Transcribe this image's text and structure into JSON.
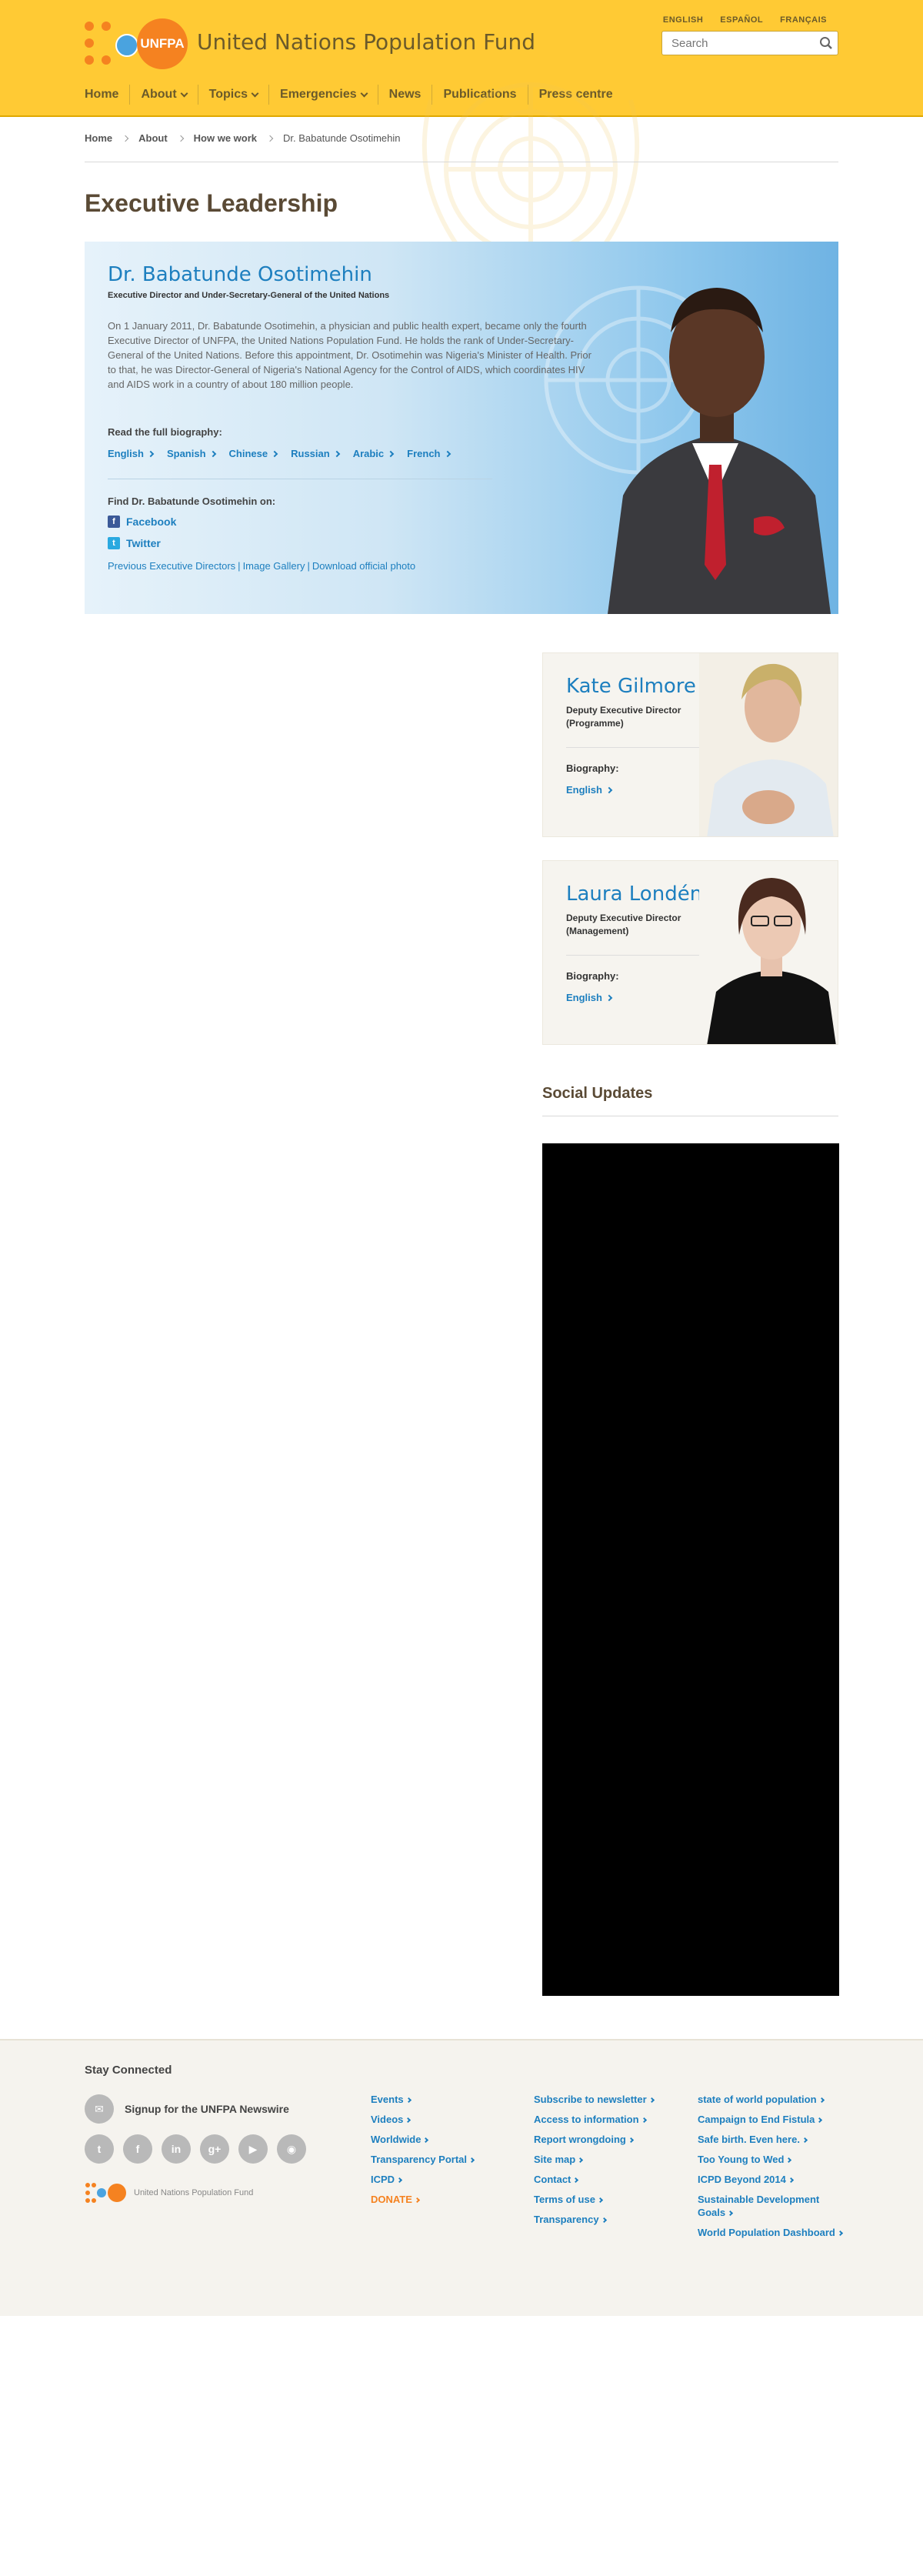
{
  "header": {
    "logo_text": "UNFPA",
    "site_title": "United Nations Population Fund",
    "languages": [
      "ENGLISH",
      "ESPAÑOL",
      "FRANÇAIS"
    ],
    "search_placeholder": "Search",
    "nav": [
      {
        "label": "Home",
        "dropdown": false
      },
      {
        "label": "About",
        "dropdown": true
      },
      {
        "label": "Topics",
        "dropdown": true
      },
      {
        "label": "Emergencies",
        "dropdown": true
      },
      {
        "label": "News",
        "dropdown": false
      },
      {
        "label": "Publications",
        "dropdown": false
      },
      {
        "label": "Press centre",
        "dropdown": false
      }
    ]
  },
  "breadcrumb": [
    "Home",
    "About",
    "How we work",
    "Dr. Babatunde Osotimehin"
  ],
  "page_title": "Executive Leadership",
  "feature": {
    "name": "Dr. Babatunde Osotimehin",
    "role": "Executive Director and Under-Secretary-General of the United Nations",
    "bio": "On 1 January 2011, Dr. Babatunde Osotimehin, a physician and public health expert, became only the fourth Executive Director of UNFPA, the United Nations Population Fund. He holds the rank of Under-Secretary-General of the United Nations. Before this appointment, Dr. Osotimehin was Nigeria's Minister of Health. Prior to that, he was Director-General of Nigeria's National Agency for the Control of AIDS, which coordinates HIV and AIDS work in a country of about 180 million people.",
    "read_label": "Read the full biography:",
    "languages": [
      "English",
      "Spanish",
      "Chinese",
      "Russian",
      "Arabic",
      "French"
    ],
    "find_label": "Find Dr. Babatunde Osotimehin on:",
    "facebook": "Facebook",
    "twitter": "Twitter",
    "links": [
      "Previous Executive Directors",
      "Image Gallery",
      "Download official photo"
    ]
  },
  "deputies": [
    {
      "name": "Kate Gilmore",
      "role": "Deputy Executive Director (Programme)",
      "bio_label": "Biography:",
      "language": "English"
    },
    {
      "name": "Laura Londén",
      "role": "Deputy Executive Director (Management)",
      "bio_label": "Biography:",
      "language": "English"
    }
  ],
  "social_updates": "Social Updates",
  "footer": {
    "stay_connected": "Stay Connected",
    "newswire": "Signup for the UNFPA Newswire",
    "social_icons": [
      "twitter-icon",
      "facebook-icon",
      "linkedin-icon",
      "googleplus-icon",
      "youtube-icon",
      "rss-icon"
    ],
    "logo_caption": "United Nations Population Fund",
    "col1": [
      "Events",
      "Videos",
      "Worldwide",
      "Transparency Portal",
      "ICPD",
      "DONATE"
    ],
    "col2": [
      "Subscribe to newsletter",
      "Access to information",
      "Report wrongdoing",
      "Site map",
      "Contact",
      "Terms of use",
      "Transparency"
    ],
    "col3": [
      "state of world population",
      "Campaign to End Fistula",
      "Safe birth. Even here.",
      "Too Young to Wed",
      "ICPD Beyond 2014",
      "Sustainable Development Goals",
      "World Population Dashboard"
    ]
  },
  "colors": {
    "header_bg": "#ffca34",
    "accent_blue": "#1d7fbf",
    "brand_orange": "#f58220"
  }
}
